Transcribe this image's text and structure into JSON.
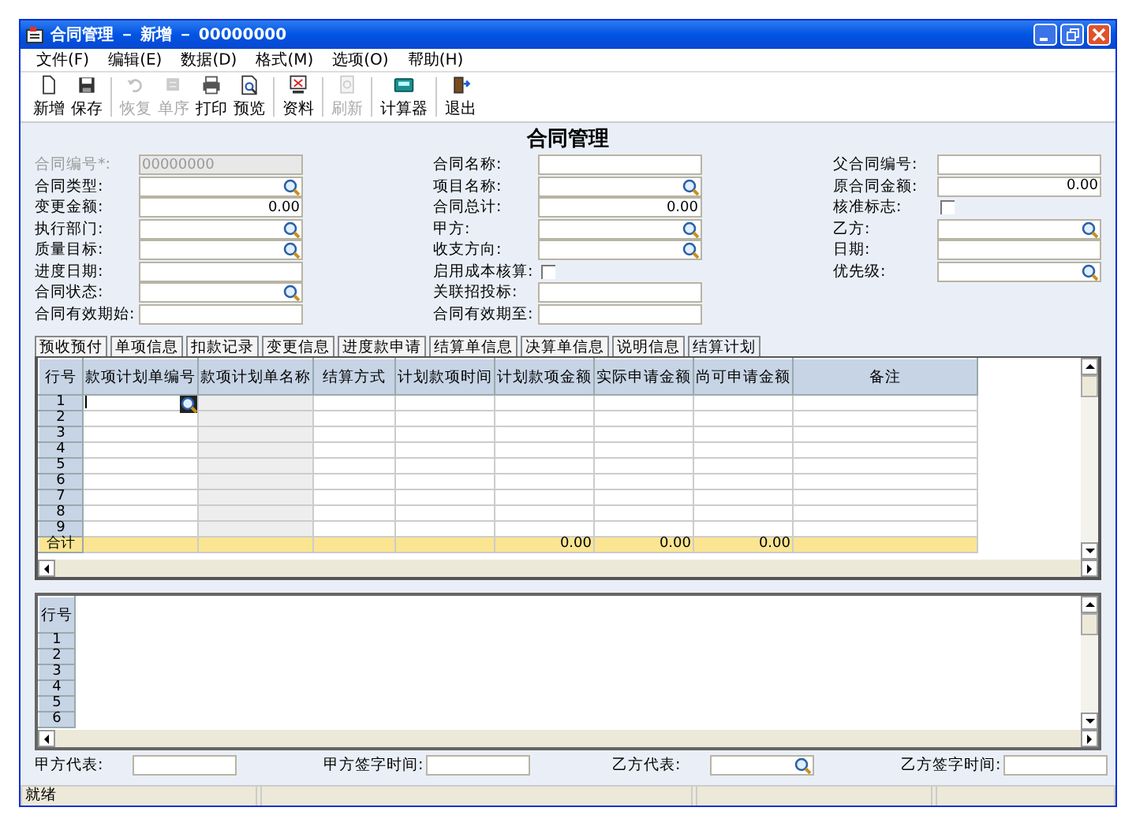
{
  "window": {
    "title": "合同管理 － 新增 － 00000000"
  },
  "menu": [
    "文件(F)",
    "编辑(E)",
    "数据(D)",
    "格式(M)",
    "选项(O)",
    "帮助(H)"
  ],
  "toolbar": [
    [
      {
        "label": "新增",
        "disabled": false
      },
      {
        "label": "保存",
        "disabled": false
      }
    ],
    [
      {
        "label": "恢复",
        "disabled": true
      },
      {
        "label": "单序",
        "disabled": true
      },
      {
        "label": "打印",
        "disabled": false
      },
      {
        "label": "预览",
        "disabled": false
      }
    ],
    [
      {
        "label": "资料",
        "disabled": false
      }
    ],
    [
      {
        "label": "刷新",
        "disabled": true
      }
    ],
    [
      {
        "label": "计算器",
        "disabled": false
      }
    ],
    [
      {
        "label": "退出",
        "disabled": false
      }
    ]
  ],
  "form": {
    "title": "合同管理",
    "columns": [
      [
        {
          "label": "合同编号*:",
          "kind": "text",
          "value": "00000000",
          "disabled": true
        },
        {
          "label": "合同类型:",
          "kind": "lookup",
          "disabled": false
        },
        {
          "label": "变更金额:",
          "kind": "number",
          "value": "0.00",
          "disabled": false
        },
        {
          "label": "执行部门:",
          "kind": "lookup",
          "disabled": false
        },
        {
          "label": "质量目标:",
          "kind": "lookup",
          "disabled": false
        },
        {
          "label": "进度日期:",
          "kind": "text",
          "disabled": false
        },
        {
          "label": "合同状态:",
          "kind": "lookup",
          "disabled": false
        },
        {
          "label": "合同有效期始:",
          "kind": "text",
          "disabled": false
        }
      ],
      [
        {
          "label": "合同名称:",
          "kind": "text",
          "disabled": false
        },
        {
          "label": "项目名称:",
          "kind": "lookup",
          "disabled": false
        },
        {
          "label": "合同总计:",
          "kind": "number",
          "value": "0.00",
          "disabled": false
        },
        {
          "label": "甲方:",
          "kind": "lookup",
          "disabled": false
        },
        {
          "label": "收支方向:",
          "kind": "lookup",
          "disabled": false
        },
        {
          "label": "启用成本核算:",
          "kind": "checkbox",
          "checked": false,
          "disabled": false
        },
        {
          "label": "关联招投标:",
          "kind": "text",
          "disabled": false
        },
        {
          "label": "合同有效期至:",
          "kind": "text",
          "disabled": false
        }
      ],
      [
        {
          "label": "父合同编号:",
          "kind": "text",
          "disabled": false
        },
        {
          "label": "原合同金额:",
          "kind": "number",
          "value": "0.00",
          "disabled": false
        },
        {
          "label": "核准标志:",
          "kind": "checkbox",
          "checked": false,
          "disabled": false
        },
        {
          "label": "乙方:",
          "kind": "lookup",
          "disabled": false
        },
        {
          "label": "日期:",
          "kind": "text",
          "disabled": false
        },
        {
          "label": "优先级:",
          "kind": "lookup",
          "disabled": false
        }
      ]
    ]
  },
  "tabs": [
    {
      "label": "预收预付",
      "selected": false
    },
    {
      "label": "单项信息",
      "selected": false
    },
    {
      "label": "扣款记录",
      "selected": false
    },
    {
      "label": "变更信息",
      "selected": false
    },
    {
      "label": "进度款申请",
      "selected": false
    },
    {
      "label": "结算单信息",
      "selected": false
    },
    {
      "label": "决算单信息",
      "selected": false
    },
    {
      "label": "说明信息",
      "selected": false
    },
    {
      "label": "结算计划",
      "selected": true
    }
  ],
  "plan_grid": {
    "corner": "行号",
    "columns": [
      {
        "label": "款项计划单编号",
        "readonly": false
      },
      {
        "label": "款项计划单名称",
        "readonly": true
      },
      {
        "label": "结算方式",
        "readonly": false
      },
      {
        "label": "计划款项时间",
        "readonly": false
      },
      {
        "label": "计划款项金额",
        "readonly": false
      },
      {
        "label": "实际申请金额",
        "readonly": false
      },
      {
        "label": "尚可申请金额",
        "readonly": false
      },
      {
        "label": "备注",
        "readonly": false
      }
    ],
    "rows": [
      {
        "number": "1",
        "editing": true
      },
      {
        "number": "2",
        "editing": false
      },
      {
        "number": "3",
        "editing": false
      },
      {
        "number": "4",
        "editing": false
      },
      {
        "number": "5",
        "editing": false
      },
      {
        "number": "6",
        "editing": false
      },
      {
        "number": "7",
        "editing": false
      },
      {
        "number": "8",
        "editing": false
      },
      {
        "number": "9",
        "editing": false
      }
    ],
    "total": {
      "label": "合计",
      "cells": [
        null,
        null,
        null,
        null,
        "0.00",
        "0.00",
        "0.00",
        null
      ]
    }
  },
  "detail_grid": {
    "corner": "行号",
    "rows": [
      "1",
      "2",
      "3",
      "4",
      "5",
      "6"
    ]
  },
  "footer": [
    {
      "label": "甲方代表:",
      "kind": "text"
    },
    {
      "label": "甲方签字时间:",
      "kind": "text"
    },
    {
      "label": "乙方代表:",
      "kind": "lookup"
    },
    {
      "label": "乙方签字时间:",
      "kind": "text"
    }
  ],
  "status_bar": [
    "就绪"
  ]
}
